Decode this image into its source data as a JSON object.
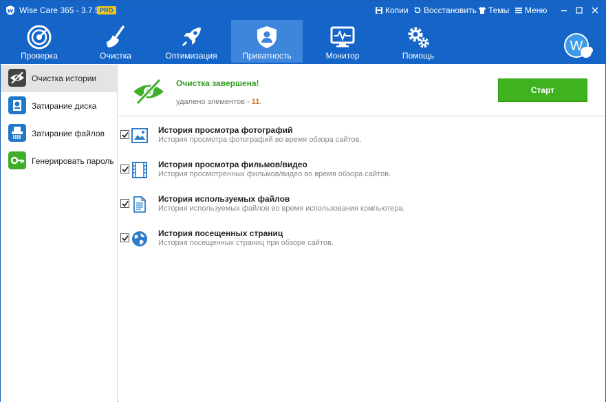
{
  "window": {
    "title": "Wise Care 365 - 3.7.5",
    "badge": "PRO",
    "actions": [
      {
        "label": "Копии",
        "icon": "save-icon"
      },
      {
        "label": "Восстановить",
        "icon": "restore-icon"
      },
      {
        "label": "Темы",
        "icon": "shirt-icon"
      },
      {
        "label": "Меню",
        "icon": "menu-icon"
      }
    ]
  },
  "nav": {
    "items": [
      {
        "label": "Проверка",
        "icon": "radar-icon"
      },
      {
        "label": "Очистка",
        "icon": "broom-icon"
      },
      {
        "label": "Оптимизация",
        "icon": "rocket-icon"
      },
      {
        "label": "Приватность",
        "icon": "shield-user-icon",
        "active": true
      },
      {
        "label": "Монитор",
        "icon": "monitor-icon"
      },
      {
        "label": "Помощь",
        "icon": "gears-icon"
      }
    ],
    "avatar": "W"
  },
  "sidebar": {
    "items": [
      {
        "label": "Очистка истории",
        "icon": "eye-slash-icon",
        "active": true
      },
      {
        "label": "Затирание диска",
        "icon": "disk-icon"
      },
      {
        "label": "Затирание файлов",
        "icon": "shredder-icon"
      },
      {
        "label": "Генерировать пароль",
        "icon": "key-icon"
      }
    ]
  },
  "status": {
    "title": "Очистка завершена!",
    "subtitle": "удалено элементов -",
    "count": "11",
    "count_suffix": "."
  },
  "start_button": "Старт",
  "items": [
    {
      "title": "История просмотра фотографий",
      "desc": "История просмотра фотографий во время обзора сайтов.",
      "checked": true,
      "icon": "image-icon"
    },
    {
      "title": "История просмотра фильмов/видео",
      "desc": "История просмотренных фильмов/видео во время обзора сайтов.",
      "checked": true,
      "icon": "film-icon"
    },
    {
      "title": "История используемых файлов",
      "desc": "История используемых файлов во время использования компьютера.",
      "checked": true,
      "icon": "document-icon"
    },
    {
      "title": "История посещенных страниц",
      "desc": "История посещенных страниц при обзоре сайтов.",
      "checked": true,
      "icon": "globe-icon"
    }
  ],
  "colors": {
    "titlebar": "#1565c8",
    "nav_active": "#3d86dc",
    "success_green": "#2e9a1e",
    "start_green": "#3fb31f",
    "count_orange": "#d27a12"
  }
}
